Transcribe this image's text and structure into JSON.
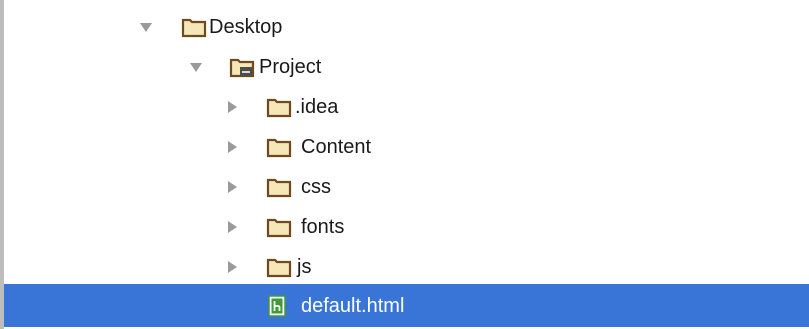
{
  "tree": {
    "items": [
      {
        "label": "Desktop",
        "icon": "folder-icon",
        "expanded": true
      },
      {
        "label": "Project",
        "icon": "project-folder-icon",
        "expanded": true
      },
      {
        "label": ".idea",
        "icon": "folder-icon",
        "expanded": false
      },
      {
        "label": "Content",
        "icon": "folder-icon",
        "expanded": false
      },
      {
        "label": "css",
        "icon": "folder-icon",
        "expanded": false
      },
      {
        "label": "fonts",
        "icon": "folder-icon",
        "expanded": false
      },
      {
        "label": "js",
        "icon": "folder-icon",
        "expanded": false
      },
      {
        "label": "default.html",
        "icon": "html-file-icon",
        "selected": true
      }
    ]
  },
  "colors": {
    "selection": "#3875d7",
    "folder_stroke": "#6f4a1f",
    "folder_fill": "#f6e7b8",
    "arrow": "#9a9a9a",
    "html_icon": "#3f9a3a"
  }
}
